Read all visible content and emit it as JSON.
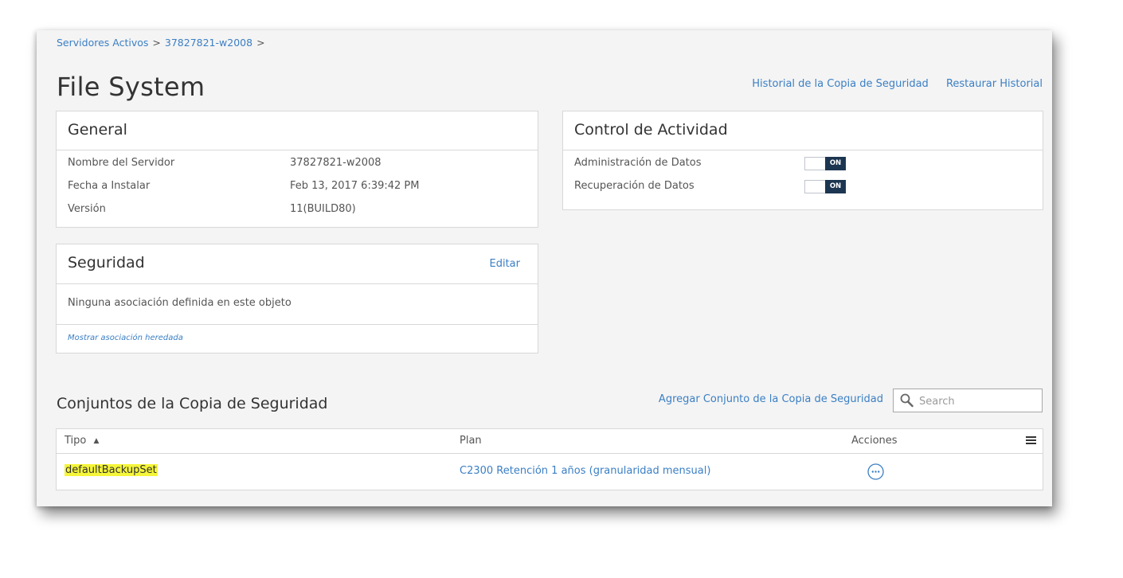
{
  "breadcrumb": {
    "items": [
      "Servidores Activos",
      "37827821-w2008"
    ],
    "separator": ">"
  },
  "page_title": "File System",
  "top_links": {
    "backup_history": "Historial de la Copia de Seguridad",
    "restore_history": "Restaurar Historial"
  },
  "general": {
    "title": "General",
    "rows": [
      {
        "label": "Nombre del Servidor",
        "value": "37827821-w2008"
      },
      {
        "label": "Fecha a Instalar",
        "value": "Feb 13, 2017 6:39:42 PM"
      },
      {
        "label": "Versión",
        "value": "11(BUILD80)"
      }
    ]
  },
  "activity": {
    "title": "Control de Actividad",
    "rows": [
      {
        "label": "Administración de Datos",
        "toggle": "ON"
      },
      {
        "label": "Recuperación de Datos",
        "toggle": "ON"
      }
    ]
  },
  "security": {
    "title": "Seguridad",
    "edit_label": "Editar",
    "empty_text": "Ninguna asociación definida en este objeto",
    "inherited_link": "Mostrar asociación heredada"
  },
  "backup_sets": {
    "title": "Conjuntos de la Copia de Seguridad",
    "add_link": "Agregar Conjunto de la Copia de Seguridad",
    "search_placeholder": "Search",
    "columns": {
      "tipo": "Tipo",
      "plan": "Plan",
      "acciones": "Acciones"
    },
    "sort_indicator": "▲",
    "rows": [
      {
        "tipo": "defaultBackupSet",
        "plan": "C2300 Retención 1 años (granularidad mensual)"
      }
    ]
  },
  "colors": {
    "link": "#3b7fc4",
    "toggle_on": "#1c3651",
    "highlight": "#f5f53a",
    "page_bg": "#f4f4f4"
  },
  "icons": [
    "search-icon",
    "sort-ascending-icon",
    "column-menu-icon",
    "more-actions-icon"
  ]
}
